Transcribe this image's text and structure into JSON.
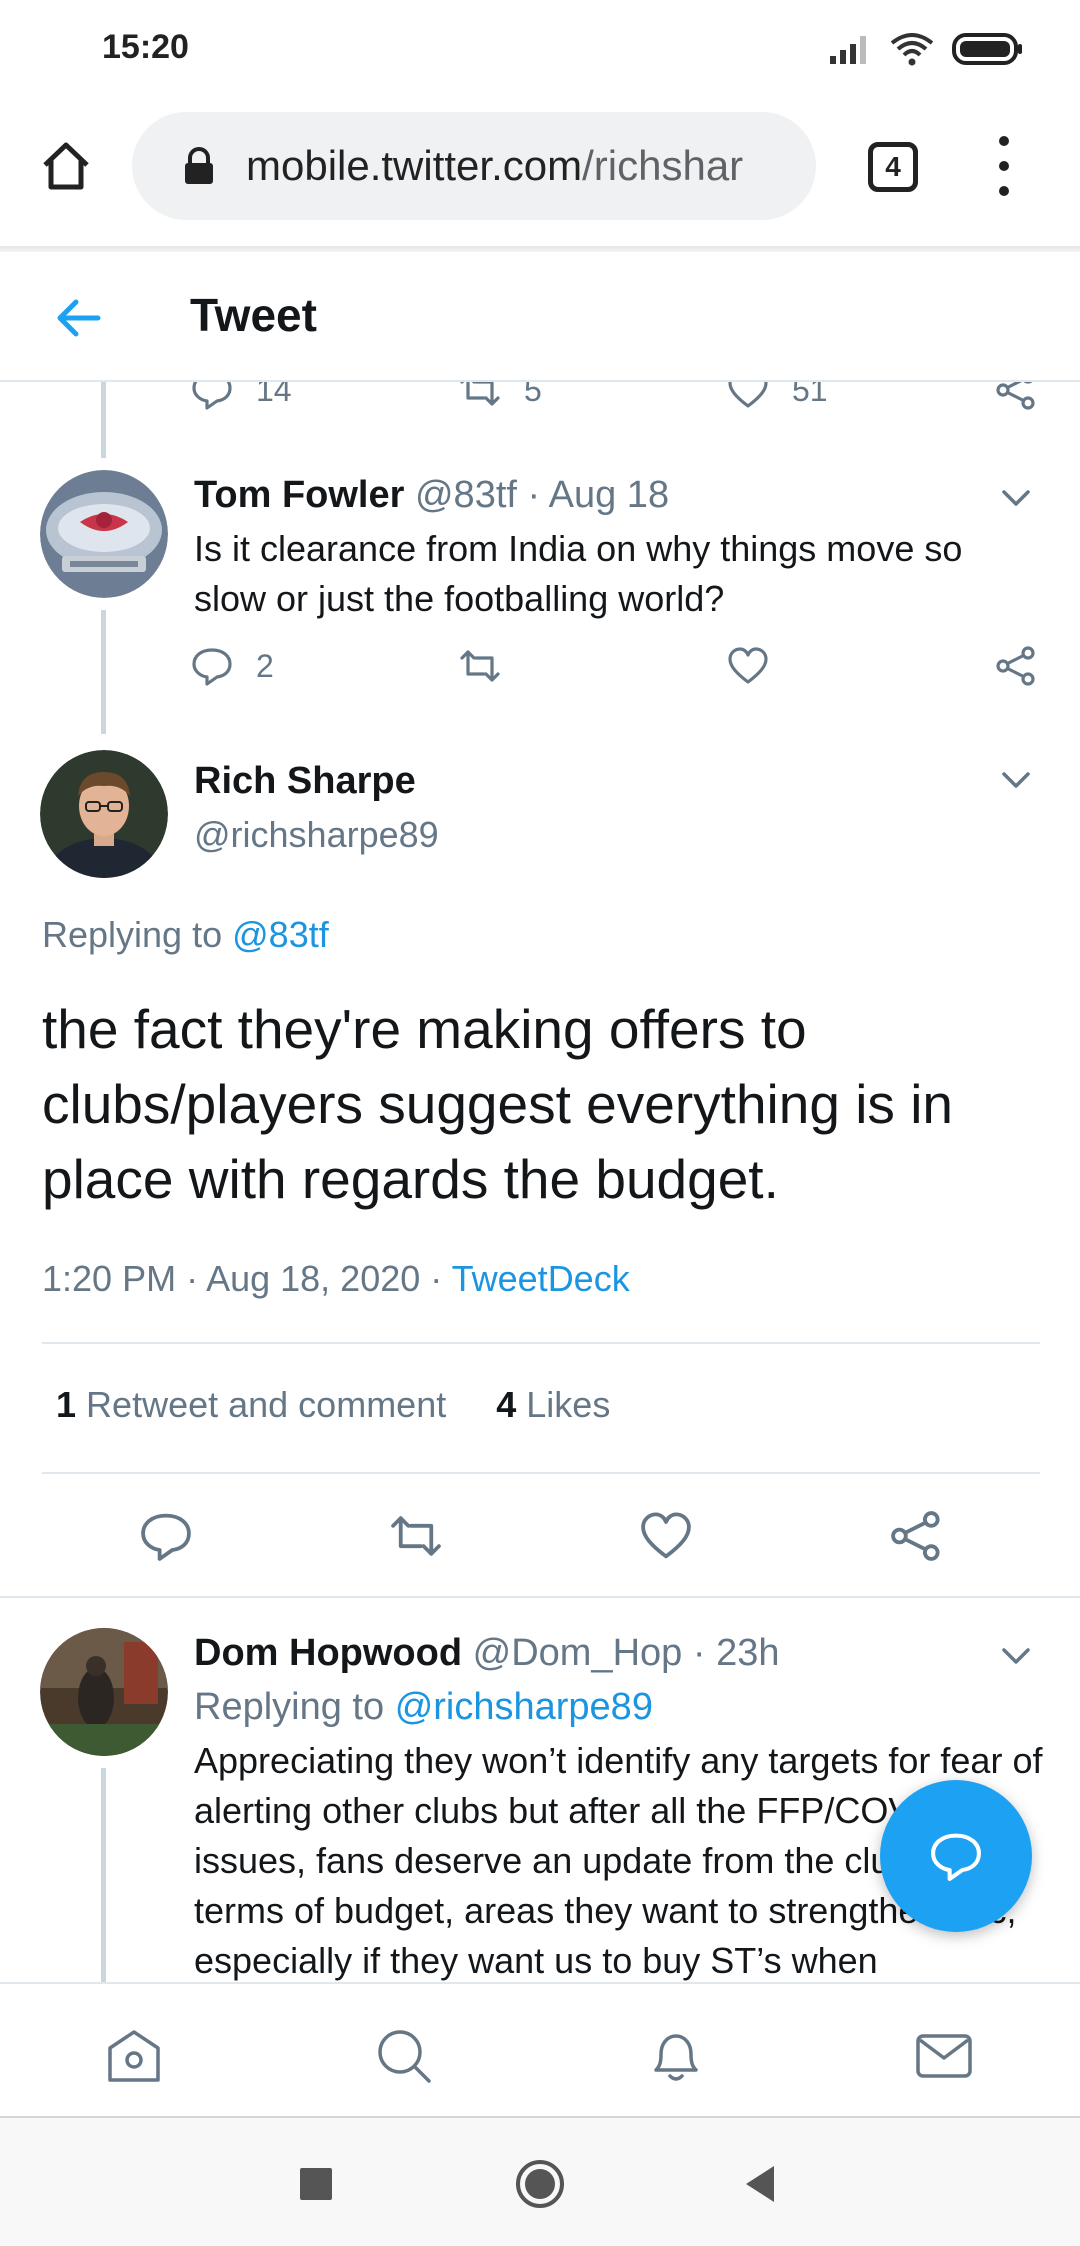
{
  "status_bar": {
    "time": "15:20",
    "icons": [
      "signal-icon",
      "wifi-icon",
      "battery-icon"
    ]
  },
  "browser": {
    "url_host": "mobile.twitter.com",
    "url_path": "/richshar",
    "tab_count": "4"
  },
  "header": {
    "title": "Tweet"
  },
  "prev_tweet_actions": {
    "replies": "14",
    "retweets": "5",
    "likes": "51"
  },
  "reply_tweet": {
    "name": "Tom Fowler",
    "handle": "@83tf",
    "separator": "·",
    "date": "Aug 18",
    "text": "Is it clearance from India on why things move so slow or just the footballing world?",
    "replies": "2"
  },
  "main_tweet": {
    "name": "Rich Sharpe",
    "handle": "@richsharpe89",
    "replying_prefix": "Replying to",
    "replying_to": "@83tf",
    "text": "the fact they're making offers to clubs/players suggest everything is in place with regards the budget.",
    "timestamp": "1:20 PM · Aug 18, 2020",
    "separator": "·",
    "source": "TweetDeck",
    "retweet_count": "1",
    "retweet_label": "Retweet and comment",
    "like_count": "4",
    "like_label": "Likes"
  },
  "next_tweet": {
    "name": "Dom Hopwood",
    "handle": "@Dom_Hop",
    "separator": "·",
    "date": "23h",
    "replying_prefix": "Replying to",
    "replying_to": "@richsharpe89",
    "text": "Appreciating they won’t identify any targets for fear of alerting other clubs but after all the FFP/COVID issues, fans deserve an update from the club in terms of budget, areas they want to strengthen, etc, especially if they want us to buy ST’s when"
  },
  "colors": {
    "accent": "#1da1f2",
    "link": "#1b95e0",
    "muted": "#657786",
    "text": "#14171a"
  }
}
